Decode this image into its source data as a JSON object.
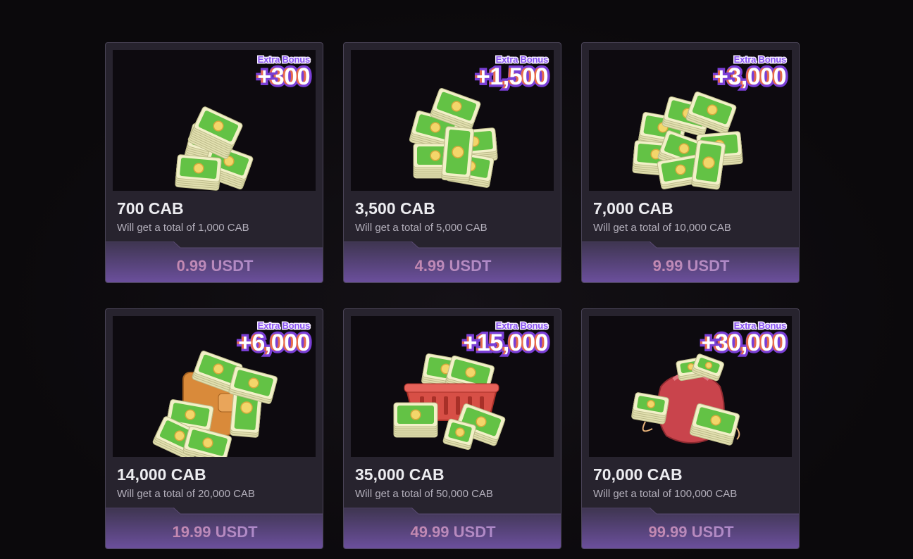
{
  "bonus_label": "Extra Bonus",
  "colors": {
    "card_bg": "#27232e",
    "card_border": "#4a4457",
    "bonus_stroke": "#7a3fd6",
    "price_bar_top": "#3e3550",
    "price_bar_bottom": "#6b4f9c",
    "price_text": "#c7889c"
  },
  "packages": [
    {
      "bonus": "+300",
      "title": "700 CAB",
      "subtitle": "Will get a total of 1,000 CAB",
      "price": "0.99 USDT",
      "art": "small-cash-stack-icon"
    },
    {
      "bonus": "+1,500",
      "title": "3,500 CAB",
      "subtitle": "Will get a total of 5,000 CAB",
      "price": "4.99 USDT",
      "art": "medium-cash-pile-icon"
    },
    {
      "bonus": "+3,000",
      "title": "7,000 CAB",
      "subtitle": "Will get a total of 10,000 CAB",
      "price": "9.99 USDT",
      "art": "large-cash-pile-icon"
    },
    {
      "bonus": "+6,000",
      "title": "14,000 CAB",
      "subtitle": "Will get a total of 20,000 CAB",
      "price": "19.99 USDT",
      "art": "wallet-with-cash-icon"
    },
    {
      "bonus": "+15,000",
      "title": "35,000 CAB",
      "subtitle": "Will get a total of 50,000 CAB",
      "price": "49.99 USDT",
      "art": "basket-with-cash-icon"
    },
    {
      "bonus": "+30,000",
      "title": "70,000 CAB",
      "subtitle": "Will get a total of 100,000 CAB",
      "price": "99.99 USDT",
      "art": "money-bag-with-cash-icon"
    }
  ]
}
